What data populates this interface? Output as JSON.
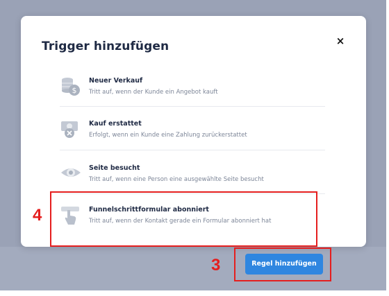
{
  "modal": {
    "title": "Trigger hinzufügen",
    "close_icon": "×",
    "options": [
      {
        "title": "Neuer Verkauf",
        "desc": "Tritt auf, wenn der Kunde ein Angebot kauft",
        "icon": "coins-dollar-icon"
      },
      {
        "title": "Kauf erstattet",
        "desc": "Erfolgt, wenn ein Kunde eine Zahlung zurückerstattet",
        "icon": "refund-money-icon"
      },
      {
        "title": "Seite besucht",
        "desc": "Tritt auf, wenn eine Person eine ausgewählte Seite besucht",
        "icon": "eye-icon"
      },
      {
        "title": "Funnelschrittformular abonniert",
        "desc": "Tritt auf, wenn der Kontakt gerade ein Formular abonniert hat",
        "icon": "pointer-hand-icon"
      }
    ]
  },
  "footer": {
    "add_rule_label": "Regel hinzufügen"
  },
  "annotations": {
    "step4": "4",
    "step3": "3"
  },
  "colors": {
    "accent": "#2f86e0",
    "highlight": "#e51e1e",
    "icon": "#b9c0cc"
  }
}
